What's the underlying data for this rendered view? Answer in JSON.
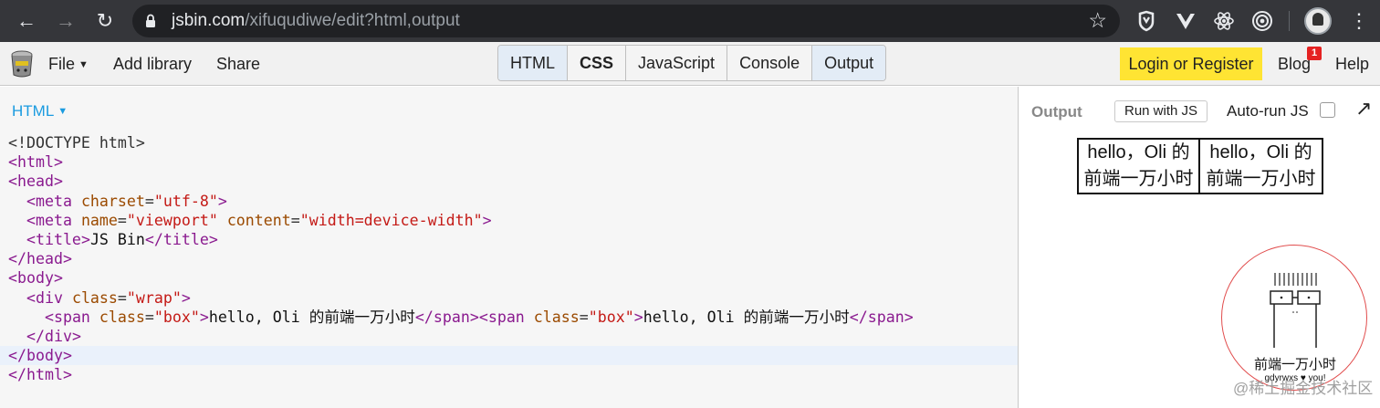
{
  "browser": {
    "url_host": "jsbin.com",
    "url_rest": "/xifuqudiwe/edit?html,output",
    "icons": [
      "back-arrow-icon",
      "forward-arrow-icon",
      "reload-icon",
      "lock-icon",
      "bookmark-star-icon",
      "shield-extension-icon",
      "vue-extension-icon",
      "react-extension-icon",
      "target-extension-icon",
      "profile-avatar",
      "menu-kebab-icon"
    ]
  },
  "toolbar": {
    "file_label": "File",
    "add_library_label": "Add library",
    "share_label": "Share",
    "panels": [
      {
        "label": "HTML",
        "active": true,
        "bold": false
      },
      {
        "label": "CSS",
        "active": false,
        "bold": true
      },
      {
        "label": "JavaScript",
        "active": false,
        "bold": false
      },
      {
        "label": "Console",
        "active": false,
        "bold": false
      },
      {
        "label": "Output",
        "active": true,
        "bold": false
      }
    ],
    "login_label": "Login or Register",
    "blog_label": "Blog",
    "blog_badge": "1",
    "help_label": "Help",
    "login_color": "#ffe433"
  },
  "editor": {
    "label": "HTML",
    "lines": [
      "<!DOCTYPE html>",
      "<html>",
      "<head>",
      "  <meta charset=\"utf-8\">",
      "  <meta name=\"viewport\" content=\"width=device-width\">",
      "  <title>JS Bin</title>",
      "</head>",
      "<body>",
      "  <div class=\"wrap\">",
      "    <span class=\"box\">hello, Oli 的前端一万小时</span><span class=\"box\">hello, Oli 的前端一万小时</span>",
      "  </div>",
      "</body>",
      "</html>"
    ],
    "highlighted_line": 11
  },
  "output": {
    "label": "Output",
    "run_button_label": "Run with JS",
    "autorun_label": "Auto-run JS",
    "autorun_checked": false,
    "boxes": [
      "hello，Oli 的前端一万小时",
      "hello，Oli 的前端一万小时"
    ]
  },
  "stamp": {
    "title": "前端一万小时",
    "subtitle": "gdyrwxs ♥ you!"
  },
  "watermark": "@稀土掘金技术社区"
}
